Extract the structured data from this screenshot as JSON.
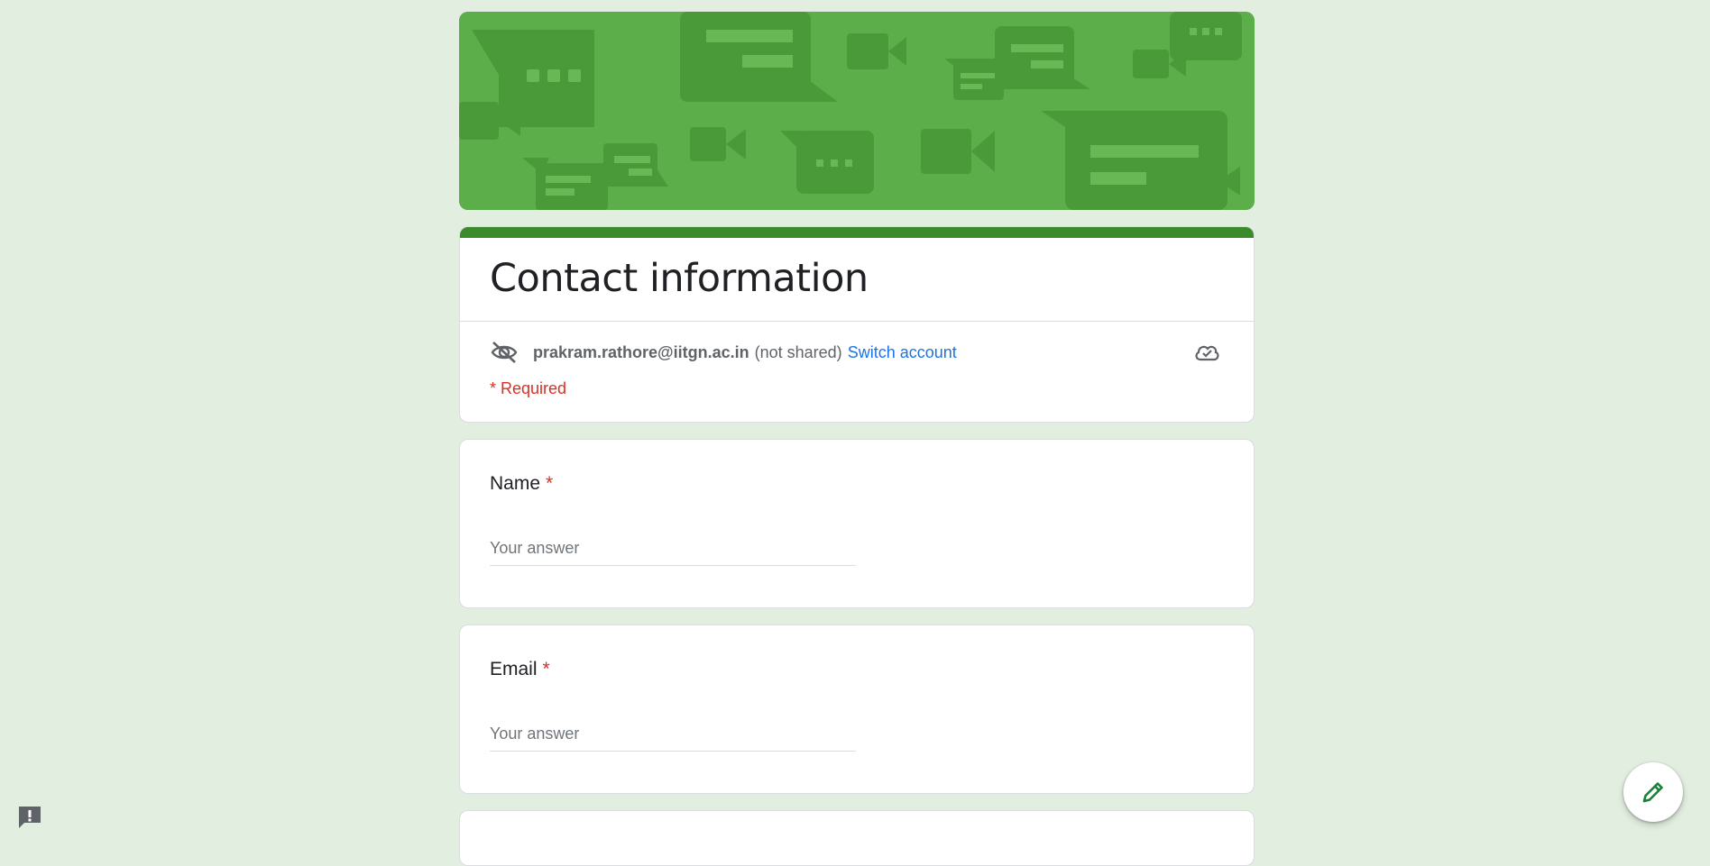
{
  "form": {
    "title": "Contact information",
    "account": {
      "email": "prakram.rathore@iitgn.ac.in",
      "note": "(not shared)",
      "switch_label": "Switch account"
    },
    "required_note": "* Required",
    "questions": [
      {
        "label": "Name",
        "required_mark": "*",
        "placeholder": "Your answer"
      },
      {
        "label": "Email",
        "required_mark": "*",
        "placeholder": "Your answer"
      }
    ]
  },
  "icons": {
    "hidden": "visibility-off-icon",
    "cloud": "cloud-done-icon",
    "fab": "pencil-edit-icon",
    "report": "report-issue-icon"
  },
  "colors": {
    "background": "#e2eee0",
    "banner": "#5cae4a",
    "accent": "#3b8a2b",
    "required": "#d93025",
    "link": "#1a73e8"
  }
}
